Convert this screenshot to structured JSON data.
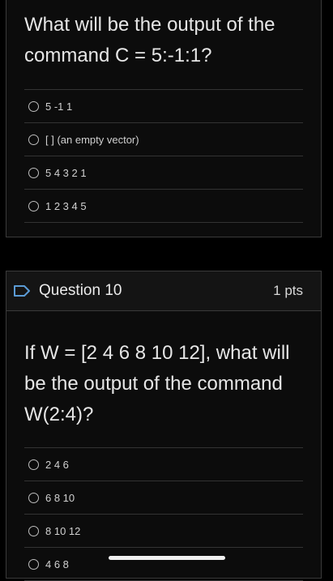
{
  "question9": {
    "text": "What will be the output of the command C = 5:-1:1?",
    "answers": [
      "5 -1 1",
      "[ ] (an empty vector)",
      "5 4 3 2 1",
      "1 2 3 4 5"
    ]
  },
  "question10": {
    "title": "Question 10",
    "points": "1 pts",
    "text": "If W = [2 4 6 8 10 12], what will be the output of the command W(2:4)?",
    "answers": [
      "2 4 6",
      "6 8 10",
      "8 10 12",
      "4 6 8"
    ]
  },
  "colors": {
    "background": "#000000",
    "card": "#0c0c0c",
    "accent_flag": "#5b9bd5"
  }
}
